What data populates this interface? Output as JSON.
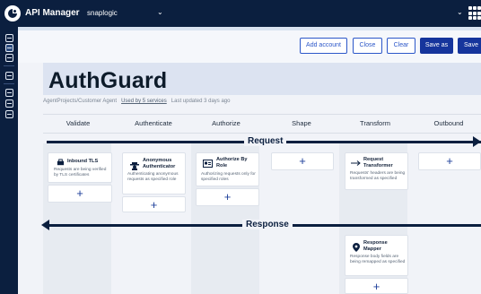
{
  "topbar": {
    "app_title": "API Manager",
    "org_name": "snaplogic",
    "org_chevron": "⌄",
    "right_chevron": "⌄"
  },
  "toolbar": {
    "add_account": "Add account",
    "close": "Close",
    "clear": "Clear",
    "save_as": "Save as",
    "save": "Save"
  },
  "page": {
    "title": "AuthGuard",
    "path": "AgentProjects/Customer Agent",
    "used_by": "Used by 5 services",
    "last_updated": "Last updated 3 days ago"
  },
  "stages": [
    "Validate",
    "Authenticate",
    "Authorize",
    "Shape",
    "Transform",
    "Outbound"
  ],
  "flows": {
    "request": "Request",
    "response": "Response"
  },
  "cards": {
    "inbound_tls": {
      "title": "Inbound TLS",
      "desc": "Requests are being verified by TLS certificates",
      "icon": "tls-icon"
    },
    "anon_auth": {
      "title_1": "Anonymous",
      "title_2": "Authenticator",
      "desc": "Authenticating anonymous requests as specified role",
      "icon": "anonymous-icon"
    },
    "authz_role": {
      "title_1": "Authorize By",
      "title_2": "Role",
      "desc": "Authorizing requests only for specified roles",
      "icon": "id-card-icon"
    },
    "req_transformer": {
      "title_1": "Request",
      "title_2": "Transformer",
      "desc": "Requests' headers are being transformed as specified",
      "icon": "arrow-transform-icon"
    },
    "resp_mapper": {
      "title_1": "Response",
      "title_2": "Mapper",
      "desc": "Response body fields are being remapped as specified",
      "icon": "map-pin-icon"
    }
  },
  "plus_symbol": "+",
  "colors": {
    "navy": "#0b1f3f",
    "primary": "#16359c",
    "outline": "#2c57c9",
    "banner": "#dce3f1"
  }
}
